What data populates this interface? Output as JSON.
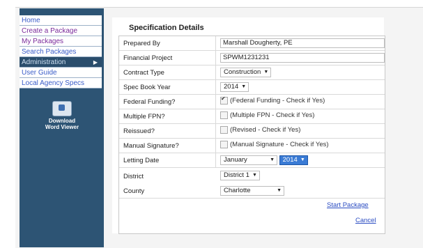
{
  "sidebar": {
    "items": [
      {
        "label": "Home"
      },
      {
        "label": "Create a Package"
      },
      {
        "label": "My Packages"
      },
      {
        "label": "Search Packages"
      },
      {
        "label": "Administration"
      },
      {
        "label": "User Guide"
      },
      {
        "label": "Local Agency Specs"
      }
    ],
    "administration_arrow": "▶",
    "download_label_1": "Download",
    "download_label_2": "Word Viewer"
  },
  "panel": {
    "title": "Specification Details"
  },
  "form": {
    "prepared_by": {
      "label": "Prepared By",
      "value": "Marshall Dougherty, PE"
    },
    "financial_project": {
      "label": "Financial Project",
      "value": "SPWM1231231"
    },
    "contract_type": {
      "label": "Contract Type",
      "value": "Construction"
    },
    "spec_book_year": {
      "label": "Spec Book Year",
      "value": "2014"
    },
    "federal_funding": {
      "label": "Federal Funding?",
      "text": "(Federal Funding - Check if Yes)",
      "checked": true
    },
    "multiple_fpn": {
      "label": "Multiple FPN?",
      "text": "(Multiple FPN - Check if Yes)",
      "checked": false
    },
    "reissued": {
      "label": "Reissued?",
      "text": "(Revised - Check if Yes)",
      "checked": false
    },
    "manual_signature": {
      "label": "Manual Signature?",
      "text": "(Manual Signature - Check if Yes)",
      "checked": false
    },
    "letting_date": {
      "label": "Letting Date",
      "month": "January",
      "year": "2014"
    },
    "district": {
      "label": "District",
      "value": "District 1"
    },
    "county": {
      "label": "County",
      "value": "Charlotte"
    }
  },
  "actions": {
    "start_package": "Start Package",
    "cancel": "Cancel"
  },
  "caret": "▼"
}
